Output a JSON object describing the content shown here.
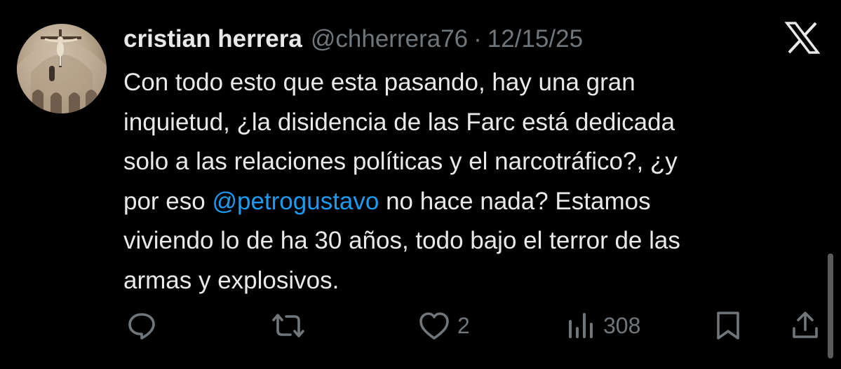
{
  "user": {
    "name": "cristian herrera",
    "handle": "@chherrera76",
    "separator": "·",
    "date": "12/15/25"
  },
  "tweet": {
    "lines": [
      [
        {
          "text": "Con todo esto que esta pasando, hay una gran"
        }
      ],
      [
        {
          "text": "inquietud, ¿la disidencia de las Farc está dedicada"
        }
      ],
      [
        {
          "text": "solo a las relaciones políticas y el narcotráfico?, ¿y"
        }
      ],
      [
        {
          "text": "por eso "
        },
        {
          "text": "@petrogustavo",
          "mention": true
        },
        {
          "text": " no hace nada? Estamos"
        }
      ],
      [
        {
          "text": "viviendo lo de ha 30 años, todo bajo el terror de las"
        }
      ],
      [
        {
          "text": "armas y explosivos."
        }
      ]
    ]
  },
  "actions": {
    "reply": {
      "icon": "reply-icon",
      "count": ""
    },
    "retweet": {
      "icon": "retweet-icon",
      "count": ""
    },
    "like": {
      "icon": "heart-icon",
      "count": "2"
    },
    "views": {
      "icon": "views-icon",
      "count": "308"
    },
    "bookmark": {
      "icon": "bookmark-icon"
    },
    "share": {
      "icon": "share-icon"
    }
  },
  "colors": {
    "background": "#000000",
    "text": "#e7e9ea",
    "secondary": "#71767b",
    "mention": "#1d9bf0"
  }
}
